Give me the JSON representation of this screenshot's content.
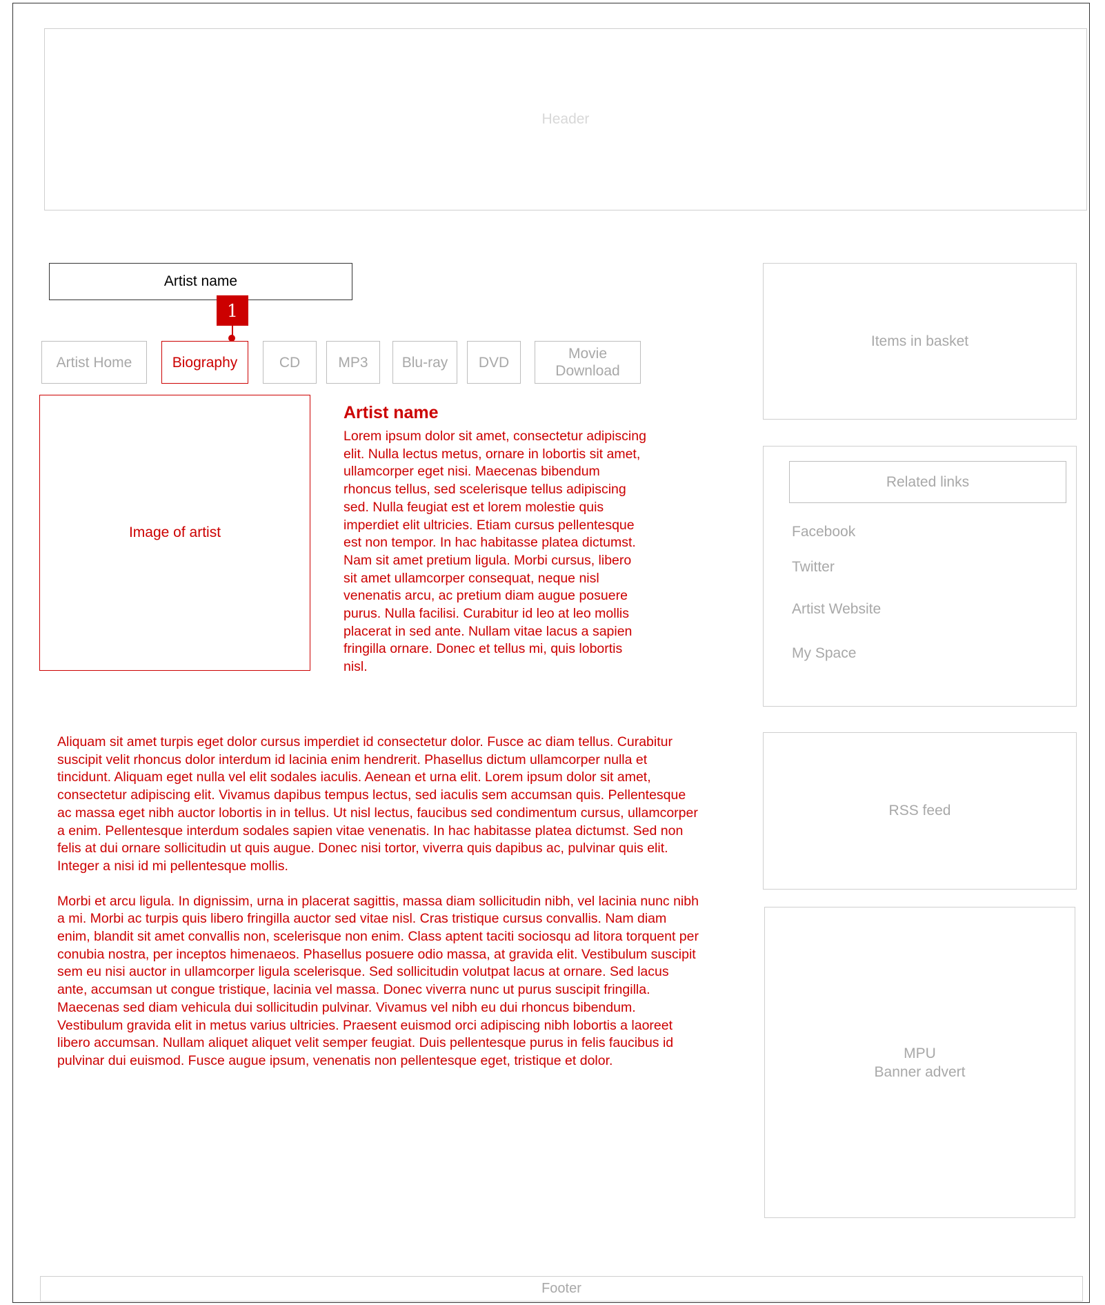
{
  "header": {
    "label": "Header"
  },
  "artist_label": "Artist name",
  "annotation_marker": "1",
  "tabs": [
    {
      "label": "Artist Home",
      "active": false
    },
    {
      "label": "Biography",
      "active": true
    },
    {
      "label": "CD",
      "active": false
    },
    {
      "label": "MP3",
      "active": false
    },
    {
      "label": "Blu-ray",
      "active": false
    },
    {
      "label": "DVD",
      "active": false
    },
    {
      "label": "Movie Download",
      "active": false
    }
  ],
  "image_placeholder": "Image of artist",
  "bio": {
    "heading": "Artist name",
    "intro": "Lorem ipsum dolor sit amet, consectetur adipiscing elit. Nulla lectus metus, ornare in lobortis sit amet, ullamcorper eget nisi. Maecenas bibendum rhoncus tellus, sed scelerisque tellus adipiscing sed. Nulla feugiat est et lorem molestie quis imperdiet elit ultricies. Etiam cursus pellentesque est non tempor. In hac habitasse platea dictumst. Nam sit amet pretium ligula. Morbi cursus, libero sit amet ullamcorper consequat, neque nisl venenatis arcu, ac pretium diam augue posuere purus. Nulla facilisi. Curabitur id leo at leo mollis placerat in sed ante. Nullam vitae lacus a sapien fringilla ornare. Donec et tellus mi, quis lobortis nisl.",
    "paragraph_1": "Aliquam sit amet turpis eget dolor cursus imperdiet id consectetur dolor. Fusce ac diam tellus. Curabitur suscipit velit rhoncus dolor interdum id lacinia enim hendrerit. Phasellus dictum ullamcorper nulla et tincidunt. Aliquam eget nulla vel elit sodales iaculis. Aenean et urna elit. Lorem ipsum dolor sit amet, consectetur adipiscing elit. Vivamus dapibus tempus lectus, sed iaculis sem accumsan quis. Pellentesque ac massa eget nibh auctor lobortis in in tellus. Ut nisl lectus, faucibus sed condimentum cursus, ullamcorper a enim. Pellentesque interdum sodales sapien vitae venenatis. In hac habitasse platea dictumst. Sed non felis at dui ornare sollicitudin ut quis augue. Donec nisi tortor, viverra quis dapibus ac, pulvinar quis elit. Integer a nisi id mi pellentesque mollis.",
    "paragraph_2": "Morbi et arcu ligula. In dignissim, urna in placerat sagittis, massa diam sollicitudin nibh, vel lacinia nunc nibh a mi. Morbi ac turpis quis libero fringilla auctor sed vitae nisl. Cras tristique cursus convallis. Nam diam enim, blandit sit amet convallis non, scelerisque non enim. Class aptent taciti sociosqu ad litora torquent per conubia nostra, per inceptos himenaeos. Phasellus posuere odio massa, at gravida elit. Vestibulum suscipit sem eu nisi auctor in ullamcorper ligula scelerisque. Sed sollicitudin volutpat lacus at ornare. Sed lacus ante, accumsan ut congue tristique, lacinia vel massa. Donec viverra nunc ut purus suscipit fringilla. Maecenas sed diam vehicula dui sollicitudin pulvinar. Vivamus vel nibh eu dui rhoncus bibendum. Vestibulum gravida elit in metus varius ultricies. Praesent euismod orci adipiscing nibh lobortis a laoreet libero accumsan. Nullam aliquet aliquet velit semper feugiat. Duis pellentesque purus in felis faucibus id pulvinar dui euismod. Fusce augue ipsum, venenatis non pellentesque eget, tristique et dolor."
  },
  "sidebar": {
    "basket": "Items in basket",
    "related_links": {
      "title": "Related links",
      "items": [
        "Facebook",
        "Twitter",
        "Artist Website",
        "My Space"
      ]
    },
    "rss": "RSS feed",
    "mpu": {
      "line1": "MPU",
      "line2": "Banner advert"
    }
  },
  "footer": {
    "label": "Footer"
  },
  "colors": {
    "accent": "#cc0000",
    "placeholder_text": "#a8a8a8",
    "border": "#cfcfcf"
  }
}
